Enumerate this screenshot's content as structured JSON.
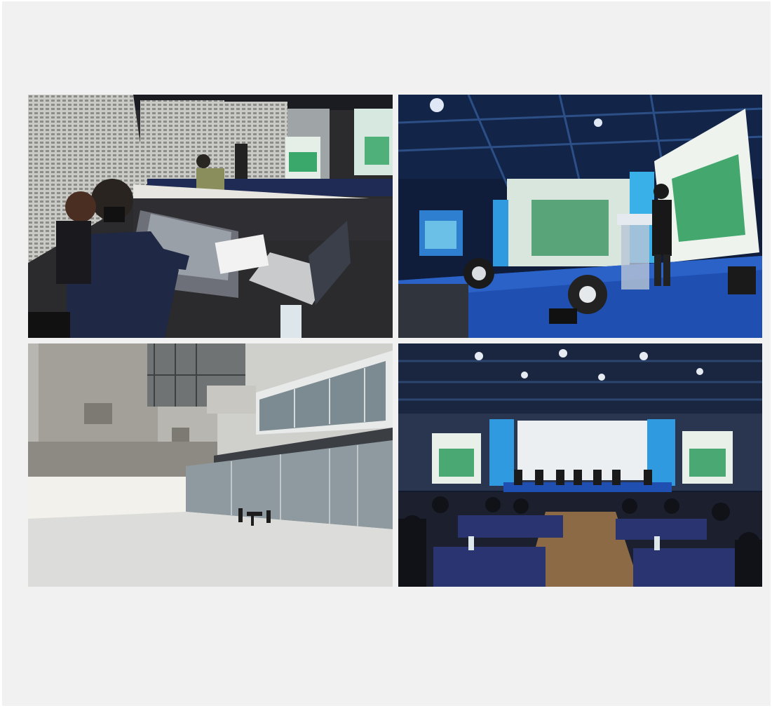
{
  "gallery": {
    "photos": [
      {
        "id": "control-booth",
        "subject": "sound-and-lighting-control-desk"
      },
      {
        "id": "stage-speech",
        "subject": "speaker-at-podium-on-blue-stage"
      },
      {
        "id": "atrium",
        "subject": "empty-concrete-atrium-with-glass-facade"
      },
      {
        "id": "panel-session",
        "subject": "panel-discussion-with-seated-audience"
      }
    ],
    "colors": {
      "panel_background": "#f1f1f1",
      "stage_blue": "#1f4fb0",
      "accent_green": "#3aa86b",
      "table_navy": "#2a3470"
    }
  }
}
